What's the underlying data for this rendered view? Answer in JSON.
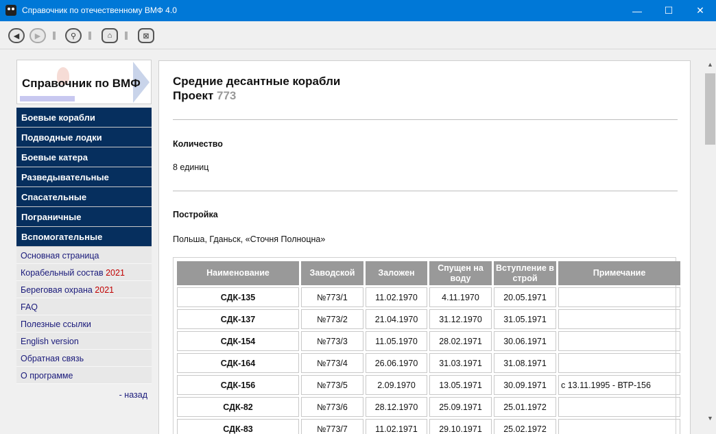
{
  "window": {
    "title": "Справочник по отечественному ВМФ 4.0",
    "minimize": "—",
    "maximize": "☐",
    "close": "✕",
    "accent_color": "#0078d7"
  },
  "toolbar": {
    "back": "◀",
    "forward": "▶",
    "search": "⚲",
    "home": "⌂",
    "exit": "⊠"
  },
  "sidebar": {
    "logo_text": "Справочник по ВМФ",
    "main_items": [
      {
        "label": "Боевые корабли"
      },
      {
        "label": "Подводные лодки"
      },
      {
        "label": "Боевые катера"
      },
      {
        "label": "Разведывательные"
      },
      {
        "label": "Спасательные"
      },
      {
        "label": "Пограничные"
      },
      {
        "label": "Вспомогательные"
      }
    ],
    "links": [
      {
        "label": "Основная страница",
        "suffix": ""
      },
      {
        "label": "Корабельный состав ",
        "suffix": "2021"
      },
      {
        "label": "Береговая охрана ",
        "suffix": "2021"
      },
      {
        "label": "FAQ",
        "suffix": ""
      },
      {
        "label": "Полезные ссылки",
        "suffix": ""
      },
      {
        "label": "English version",
        "suffix": ""
      },
      {
        "label": "Обратная связь",
        "suffix": ""
      },
      {
        "label": "О программе",
        "suffix": ""
      }
    ],
    "back_label": "- назад",
    "nav_color": "#062f5e"
  },
  "main": {
    "title_line1": "Средние десантные корабли",
    "project_label": "Проект ",
    "project_number": "773",
    "quantity_title": "Количество",
    "quantity_value": "8 единиц",
    "build_title": "Постройка",
    "build_value": "Польша, Гданьск, «Сточня Полноцна»",
    "table": {
      "headers": [
        "Наименование",
        "Заводской",
        "Заложен",
        "Спущен на воду",
        "Вступление в строй",
        "Примечание"
      ],
      "rows": [
        [
          "СДК-135",
          "№773/1",
          "11.02.1970",
          "4.11.1970",
          "20.05.1971",
          ""
        ],
        [
          "СДК-137",
          "№773/2",
          "21.04.1970",
          "31.12.1970",
          "31.05.1971",
          ""
        ],
        [
          "СДК-154",
          "№773/3",
          "11.05.1970",
          "28.02.1971",
          "30.06.1971",
          ""
        ],
        [
          "СДК-164",
          "№773/4",
          "26.06.1970",
          "31.03.1971",
          "31.08.1971",
          ""
        ],
        [
          "СДК-156",
          "№773/5",
          "2.09.1970",
          "13.05.1971",
          "30.09.1971",
          "с 13.11.1995 - ВТР-156"
        ],
        [
          "СДК-82",
          "№773/6",
          "28.12.1970",
          "25.09.1971",
          "25.01.1972",
          ""
        ],
        [
          "СДК-83",
          "№773/7",
          "11.02.1971",
          "29.10.1971",
          "25.02.1972",
          ""
        ]
      ]
    }
  },
  "scrollbar": {
    "up": "▲",
    "down": "▼"
  }
}
